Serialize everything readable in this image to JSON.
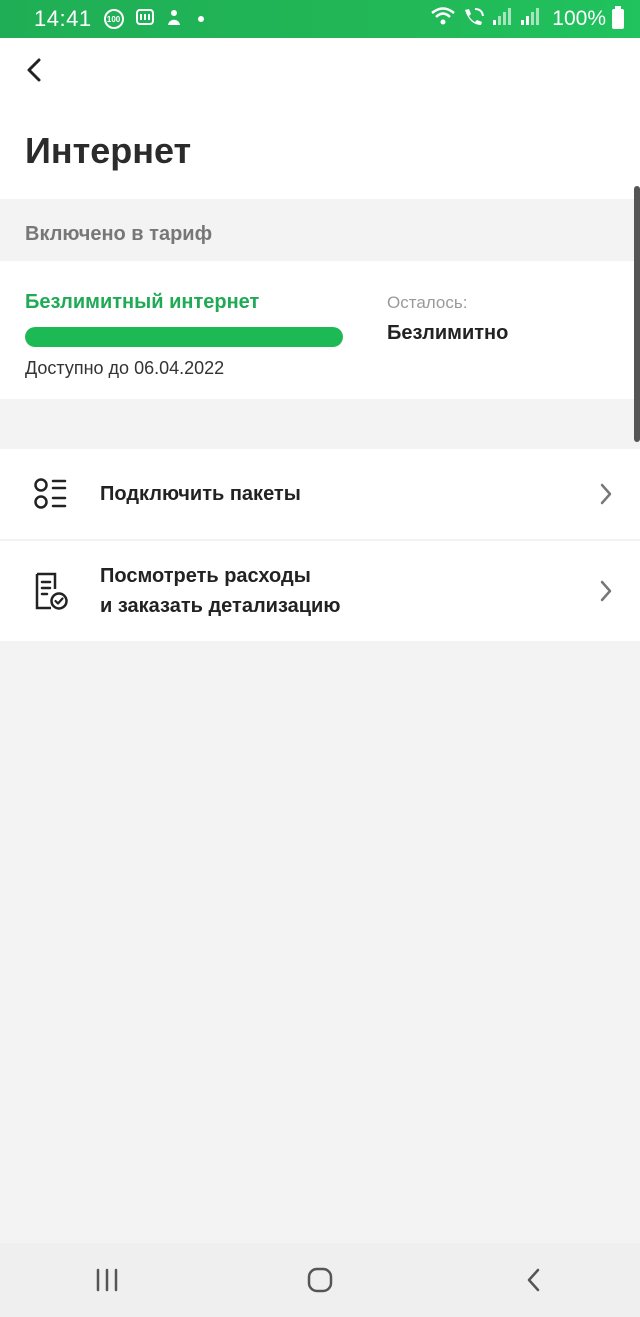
{
  "status_bar": {
    "time": "14:41",
    "badge": "100",
    "battery_text": "100%"
  },
  "header": {
    "title": "Интернет"
  },
  "section": {
    "included_label": "Включено в тариф"
  },
  "tariff": {
    "name": "Безлимитный интернет",
    "valid_until": "Доступно до 06.04.2022",
    "remaining_label": "Осталось:",
    "remaining_value": "Безлимитно",
    "progress_percent": 100,
    "accent_color": "#1db954"
  },
  "menu": {
    "items": [
      {
        "label": "Подключить пакеты",
        "icon": "list-options-icon"
      },
      {
        "label_line1": "Посмотреть расходы",
        "label_line2": "и заказать детализацию",
        "icon": "document-check-icon"
      }
    ]
  },
  "colors": {
    "status_bar": "#1fae55",
    "background": "#f3f3f3",
    "title_text": "#2b2b2b"
  }
}
